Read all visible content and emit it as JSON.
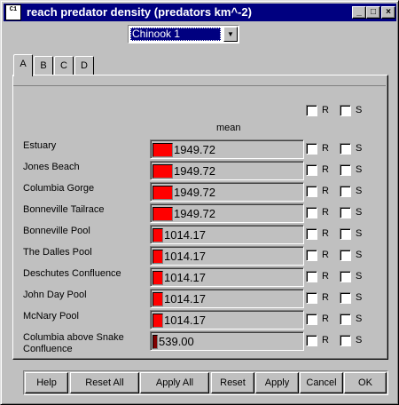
{
  "window": {
    "title": "reach predator density (predators km^-2)",
    "icon_text": "C1",
    "controls": [
      "minimize-icon",
      "maximize-icon",
      "close-icon"
    ]
  },
  "species_select": {
    "value": "Chinook 1"
  },
  "tabs": [
    {
      "label": "A",
      "active": true
    },
    {
      "label": "B",
      "active": false
    },
    {
      "label": "C",
      "active": false
    },
    {
      "label": "D",
      "active": false
    }
  ],
  "column_header": "mean",
  "checkbox_labels": {
    "r": "R",
    "s": "S"
  },
  "rows": [
    {
      "label": "Estuary",
      "value": "1949.72",
      "fill": 0.9
    },
    {
      "label": "Jones Beach",
      "value": "1949.72",
      "fill": 0.9
    },
    {
      "label": "Columbia Gorge",
      "value": "1949.72",
      "fill": 0.9
    },
    {
      "label": "Bonneville Tailrace",
      "value": "1949.72",
      "fill": 0.9
    },
    {
      "label": "Bonneville Pool",
      "value": "1014.17",
      "fill": 0.47
    },
    {
      "label": "The Dalles Pool",
      "value": "1014.17",
      "fill": 0.47
    },
    {
      "label": "Deschutes Confluence",
      "value": "1014.17",
      "fill": 0.47
    },
    {
      "label": "John Day Pool",
      "value": "1014.17",
      "fill": 0.47
    },
    {
      "label": "McNary Pool",
      "value": "1014.17",
      "fill": 0.47
    },
    {
      "label": "Columbia above Snake Confluence",
      "value": "539.00",
      "fill": 0.25
    }
  ],
  "buttons": {
    "help": "Help",
    "reset_all": "Reset All",
    "apply_all": "Apply All",
    "reset": "Reset",
    "apply": "Apply",
    "cancel": "Cancel",
    "ok": "OK"
  },
  "colors": {
    "titlebar": "#000080",
    "bar": "#ff0000",
    "face": "#c0c0c0"
  }
}
